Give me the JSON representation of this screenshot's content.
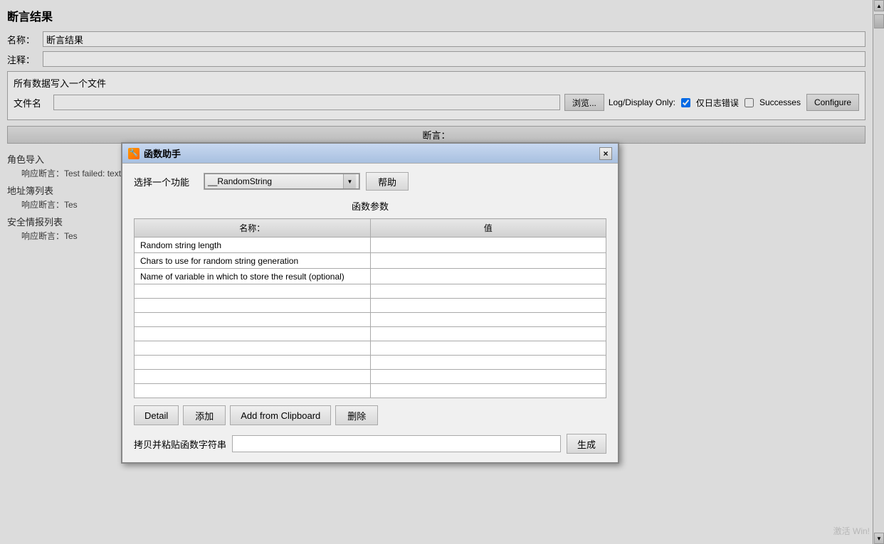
{
  "page": {
    "title": "断言结果",
    "name_label": "名称：",
    "name_value": "断言结果",
    "comment_label": "注释：",
    "comment_value": "",
    "all_data_label": "所有数据写入一个文件",
    "filename_label": "文件名",
    "filename_value": "",
    "browse_button": "浏览...",
    "log_display_label": "Log/Display Only:",
    "error_only_label": "仅日志错误",
    "error_only_checked": true,
    "successes_label": "Successes",
    "successes_checked": false,
    "configure_button": "Configure",
    "assertions_label": "断言：",
    "sidebar_items": [
      {
        "label": "角色导入",
        "response": "响应断言：Test failed: text expected not to contain /不正确/"
      },
      {
        "label": "地址簿列表",
        "response": "响应断言：Tes"
      },
      {
        "label": "安全情报列表",
        "response": "响应断言：Tes"
      }
    ]
  },
  "modal": {
    "title": "函数助手",
    "icon": "🔧",
    "close_btn": "×",
    "select_label": "选择一个功能",
    "selected_function": "__RandomString",
    "help_button": "帮助",
    "params_title": "函数参数",
    "col_name": "名称：",
    "col_value": "值",
    "params": [
      {
        "name": "Random string length",
        "value": ""
      },
      {
        "name": "Chars to use for random string generation",
        "value": ""
      },
      {
        "name": "Name of variable in which to store the result (optional)",
        "value": ""
      }
    ],
    "empty_rows_count": 8,
    "detail_button": "Detail",
    "add_button": "添加",
    "add_from_clipboard_button": "Add from Clipboard",
    "delete_button": "删除",
    "copy_label": "拷贝并粘贴函数字符串",
    "copy_value": "",
    "generate_button": "生成"
  },
  "watermark": "激活 Win!"
}
